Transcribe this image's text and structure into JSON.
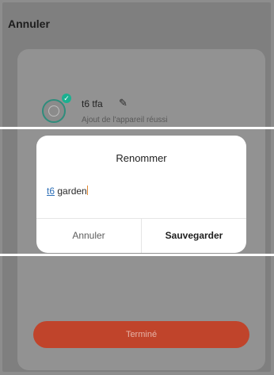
{
  "header": {
    "cancel_label": "Annuler"
  },
  "device": {
    "name": "t6 tfa",
    "status": "Ajout de l'appareil réussi"
  },
  "dialog": {
    "title": "Renommer",
    "input_prefix": "t6",
    "input_rest": " garden",
    "cancel_label": "Annuler",
    "save_label": "Sauvegarder"
  },
  "footer": {
    "done_label": "Terminé"
  },
  "colors": {
    "accent_orange": "#c0442b",
    "success_green": "#1bb090",
    "link_blue": "#2d6fb7"
  }
}
